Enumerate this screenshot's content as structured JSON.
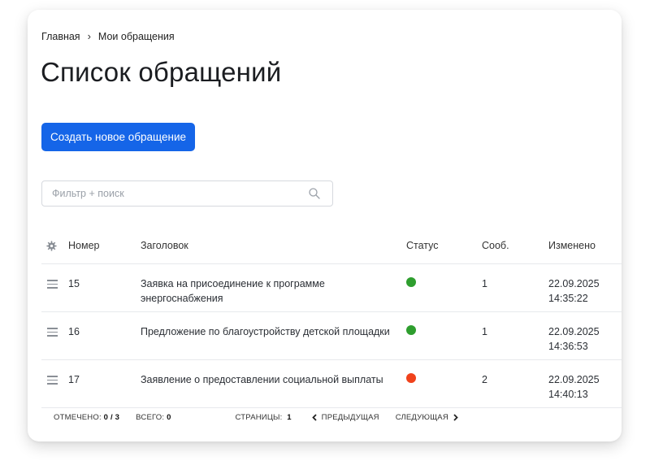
{
  "breadcrumb": {
    "home": "Главная",
    "separator": "›",
    "current": "Мои обращения"
  },
  "page": {
    "title": "Список обращений"
  },
  "actions": {
    "create_label": "Создать новое обращение"
  },
  "search": {
    "placeholder": "Фильтр + поиск",
    "value": ""
  },
  "table": {
    "columns": {
      "number": "Номер",
      "title": "Заголовок",
      "status": "Статус",
      "messages": "Сооб.",
      "modified": "Изменено"
    },
    "rows": [
      {
        "number": "15",
        "title_line1": "Заявка на присоединение к программе",
        "title_line2": "энергоснабжения",
        "status_color": "#2e9e2e",
        "messages": "1",
        "date": "22.09.2025",
        "time": "14:35:22"
      },
      {
        "number": "16",
        "title_line1": "Предложение по благоустройству детской площадки",
        "title_line2": "",
        "status_color": "#2e9e2e",
        "messages": "1",
        "date": "22.09.2025",
        "time": "14:36:53"
      },
      {
        "number": "17",
        "title_line1": "Заявление о предоставлении социальной выплаты",
        "title_line2": "",
        "status_color": "#f0421b",
        "messages": "2",
        "date": "22.09.2025",
        "time": "14:40:13"
      }
    ]
  },
  "footer": {
    "selected_label": "ОТМЕЧЕНО:",
    "selected_value": "0 / 3",
    "total_label": "ВСЕГО:",
    "total_value": "0",
    "pages_label": "СТРАНИЦЫ:",
    "pages_value": "1",
    "prev_label": "ПРЕДЫДУЩАЯ",
    "next_label": "СЛЕДУЮЩАЯ"
  },
  "colors": {
    "accent": "#1565e8",
    "status_green": "#2e9e2e",
    "status_red": "#f0421b"
  },
  "icons": {
    "search": "search-icon",
    "settings": "gear-icon",
    "drag": "drag-handle-icon"
  }
}
